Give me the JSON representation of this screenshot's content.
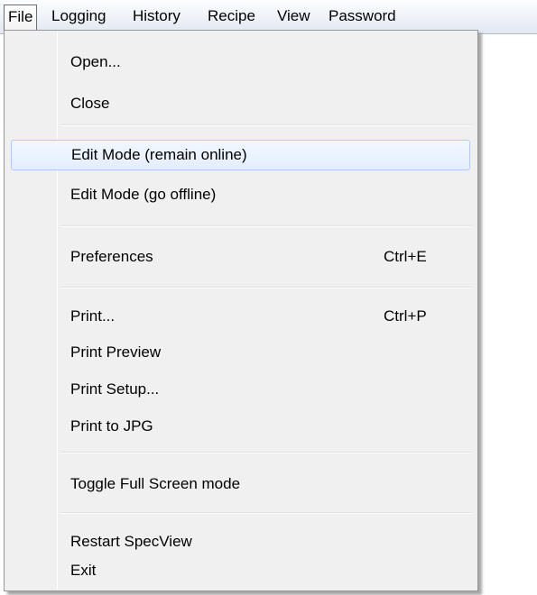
{
  "menubar": {
    "items": [
      {
        "label": "File",
        "active": true
      },
      {
        "label": "Logging"
      },
      {
        "label": "History"
      },
      {
        "label": "Recipe"
      },
      {
        "label": "View"
      },
      {
        "label": "Password"
      }
    ]
  },
  "file_menu": {
    "open": {
      "label": "Open..."
    },
    "close": {
      "label": "Close"
    },
    "edit_online": {
      "label": "Edit Mode (remain online)",
      "highlighted": true
    },
    "edit_offline": {
      "label": "Edit Mode (go offline)"
    },
    "preferences": {
      "label": "Preferences",
      "shortcut": "Ctrl+E"
    },
    "print": {
      "label": "Print...",
      "shortcut": "Ctrl+P"
    },
    "print_preview": {
      "label": "Print Preview"
    },
    "print_setup": {
      "label": "Print Setup..."
    },
    "print_jpg": {
      "label": "Print to JPG"
    },
    "toggle_fullscreen": {
      "label": "Toggle Full Screen mode"
    },
    "restart": {
      "label": "Restart SpecView"
    },
    "exit": {
      "label": "Exit"
    }
  },
  "colors": {
    "menu_background": "#f0f0f0",
    "highlight_border": "#aecdf4",
    "highlight_fill": "#e3eefc"
  }
}
